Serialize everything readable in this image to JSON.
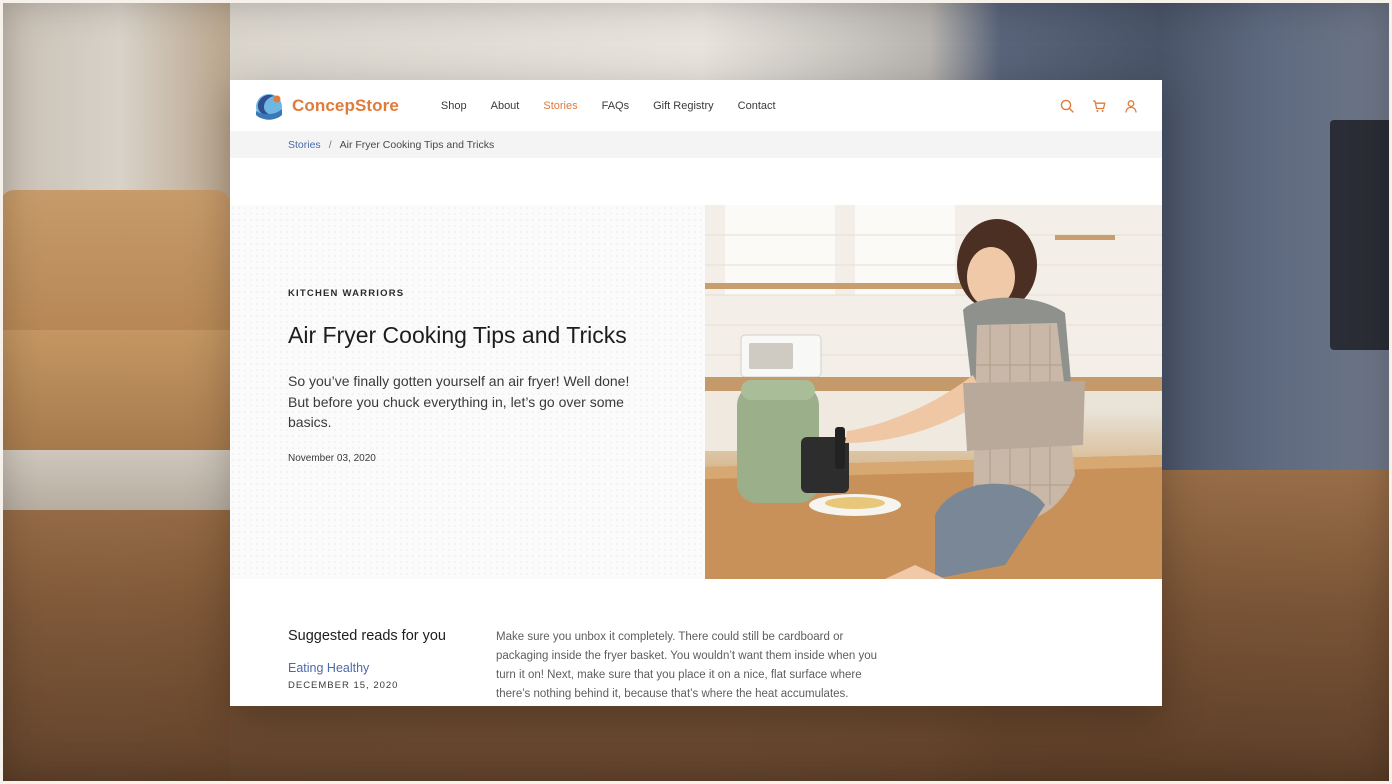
{
  "brand": {
    "name": "ConcepStore",
    "accent": "#e07b39",
    "link": "#4b6aa8"
  },
  "nav": {
    "items": [
      {
        "label": "Shop",
        "active": false
      },
      {
        "label": "About",
        "active": false
      },
      {
        "label": "Stories",
        "active": true
      },
      {
        "label": "FAQs",
        "active": false
      },
      {
        "label": "Gift Registry",
        "active": false
      },
      {
        "label": "Contact",
        "active": false
      }
    ],
    "icons": [
      "search-icon",
      "cart-icon",
      "user-icon"
    ]
  },
  "breadcrumb": {
    "parent": "Stories",
    "separator": "/",
    "current": "Air Fryer Cooking Tips and Tricks"
  },
  "article": {
    "category": "KITCHEN WARRIORS",
    "title": "Air Fryer Cooking Tips and Tricks",
    "lede": "So you’ve finally gotten yourself an air fryer! Well done! But before you chuck everything in, let’s go over some basics.",
    "date": "November 03, 2020",
    "body": "Make sure you unbox it completely. There could still be cardboard or packaging inside the fryer basket. You wouldn’t want them inside when you turn it on! Next, make sure that you place it on a nice, flat surface where there’s nothing behind it, because that’s where the heat accumulates."
  },
  "suggested": {
    "heading": "Suggested reads for you",
    "items": [
      {
        "title": "Eating Healthy",
        "date": "DECEMBER 15, 2020"
      }
    ]
  }
}
